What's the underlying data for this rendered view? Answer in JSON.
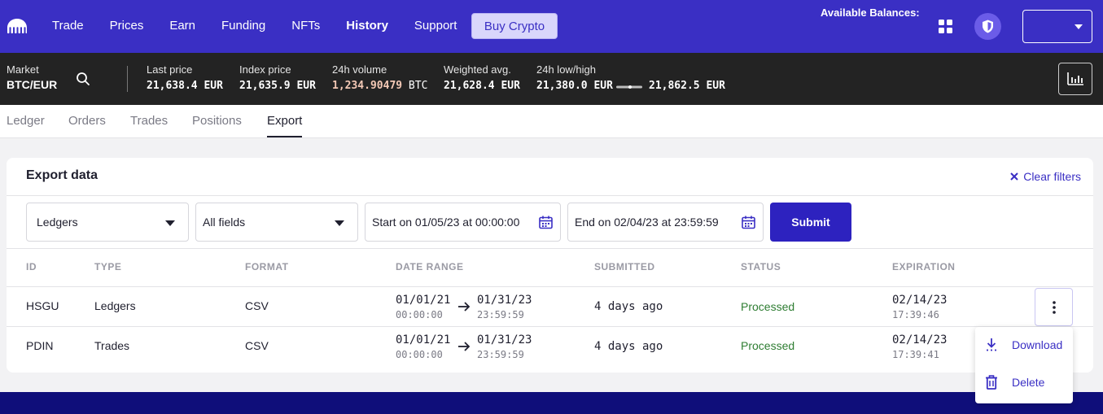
{
  "nav": {
    "items": [
      "Trade",
      "Prices",
      "Earn",
      "Funding",
      "NFTs",
      "History",
      "Support"
    ],
    "active": "History",
    "buy_label": "Buy Crypto",
    "balances_label": "Available Balances:"
  },
  "ticker": {
    "market_label": "Market",
    "market_value": "BTC/EUR",
    "last_price_label": "Last price",
    "last_price": "21,638.4 EUR",
    "index_price_label": "Index price",
    "index_price": "21,635.9 EUR",
    "volume_label": "24h volume",
    "volume_num": "1,234.90479",
    "volume_unit": "BTC",
    "wavg_label": "Weighted avg.",
    "wavg": "21,628.4 EUR",
    "lowhigh_label": "24h low/high",
    "low": "21,380.0 EUR",
    "high": "21,862.5 EUR"
  },
  "tabs": [
    "Ledger",
    "Orders",
    "Trades",
    "Positions",
    "Export"
  ],
  "active_tab": "Export",
  "export": {
    "title": "Export data",
    "clear_filters": "Clear filters",
    "type_value": "Ledgers",
    "fields_value": "All fields",
    "start_value": "Start on 01/05/23 at 00:00:00",
    "end_value": "End on 02/04/23 at 23:59:59",
    "submit_label": "Submit",
    "headers": [
      "ID",
      "TYPE",
      "FORMAT",
      "DATE RANGE",
      "SUBMITTED",
      "STATUS",
      "EXPIRATION"
    ],
    "rows": [
      {
        "id": "HSGU",
        "type": "Ledgers",
        "format": "CSV",
        "from_date": "01/01/21",
        "from_time": "00:00:00",
        "to_date": "01/31/23",
        "to_time": "23:59:59",
        "submitted": "4 days ago",
        "status": "Processed",
        "exp_date": "02/14/23",
        "exp_time": "17:39:46"
      },
      {
        "id": "PDIN",
        "type": "Trades",
        "format": "CSV",
        "from_date": "01/01/21",
        "from_time": "00:00:00",
        "to_date": "01/31/23",
        "to_time": "23:59:59",
        "submitted": "4 days ago",
        "status": "Processed",
        "exp_date": "02/14/23",
        "exp_time": "17:39:41"
      }
    ]
  },
  "row_menu": {
    "download": "Download",
    "delete": "Delete"
  },
  "colors": {
    "brand": "#3a2fc4",
    "status_processed": "#2e7d32",
    "ticker_bg": "#232323"
  },
  "icons": [
    "kraken-logo-icon",
    "grid-icon",
    "shield-icon",
    "search-icon",
    "chart-icon",
    "close-icon",
    "calendar-icon",
    "arrow-right-icon",
    "kebab-icon",
    "download-icon",
    "trash-icon"
  ]
}
